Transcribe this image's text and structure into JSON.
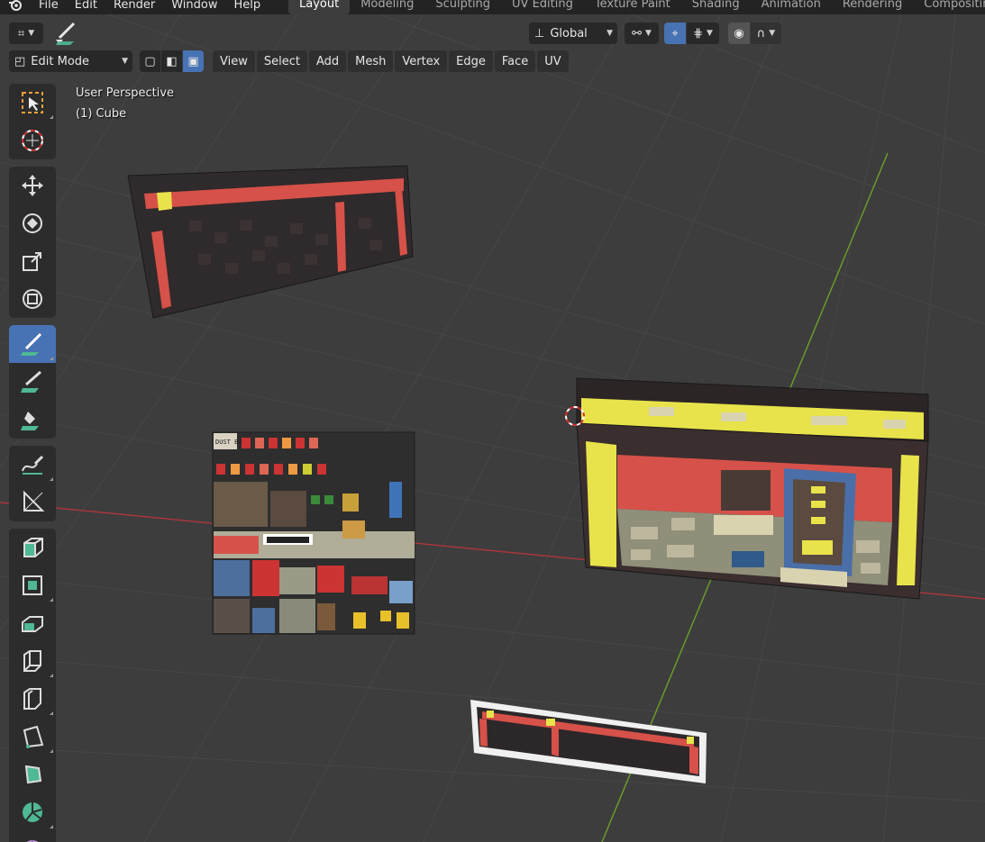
{
  "menu": {
    "logo_icon": "blender-logo-icon",
    "items": [
      "File",
      "Edit",
      "Render",
      "Window",
      "Help"
    ]
  },
  "workspaces": {
    "active": "Layout",
    "tabs": [
      "Layout",
      "Modeling",
      "Sculpting",
      "UV Editing",
      "Texture Paint",
      "Shading",
      "Animation",
      "Rendering",
      "Compositin"
    ]
  },
  "header": {
    "editor_type_icon": "editor-type-icon",
    "active_tool_icon": "annotate-tool-icon",
    "transform_orientation": "Global",
    "pivot_icon": "pivot-point-icon",
    "snap_icon": "snap-icon",
    "snap_target_icon": "snap-increment-icon",
    "proportional_icon": "proportional-edit-icon",
    "falloff_icon": "falloff-curve-icon"
  },
  "header2": {
    "mode": "Edit Mode",
    "select_modes": [
      "vertex-select-icon",
      "edge-select-icon",
      "face-select-icon"
    ],
    "menus": [
      "View",
      "Select",
      "Add",
      "Mesh",
      "Vertex",
      "Edge",
      "Face",
      "UV"
    ]
  },
  "viewport": {
    "perspective": "User Perspective",
    "object": "(1) Cube",
    "texture_atlas_text": "DUST BULB"
  },
  "tools": [
    [
      "select-box-icon",
      "cursor-icon"
    ],
    [
      "move-icon",
      "rotate-icon",
      "scale-icon",
      "transform-icon"
    ],
    [
      "annotate-icon",
      "annotate-line-icon",
      "annotate-fill-icon"
    ],
    [
      "annotate-freehand-icon",
      "measure-icon"
    ],
    [
      "add-cube-icon",
      "extrude-icon",
      "inset-icon",
      "bevel-icon",
      "loop-cut-icon",
      "knife-icon",
      "poly-build-icon",
      "spin-icon",
      "smooth-icon"
    ]
  ],
  "colors": {
    "accent": "#4772b3",
    "grid": "#4a4a4a",
    "axis_x": "#a8363a",
    "axis_y": "#6b9a2a",
    "brick_red": "#d65149",
    "trim_yellow": "#e8e34a",
    "dark_brick": "#3a2c2f"
  }
}
